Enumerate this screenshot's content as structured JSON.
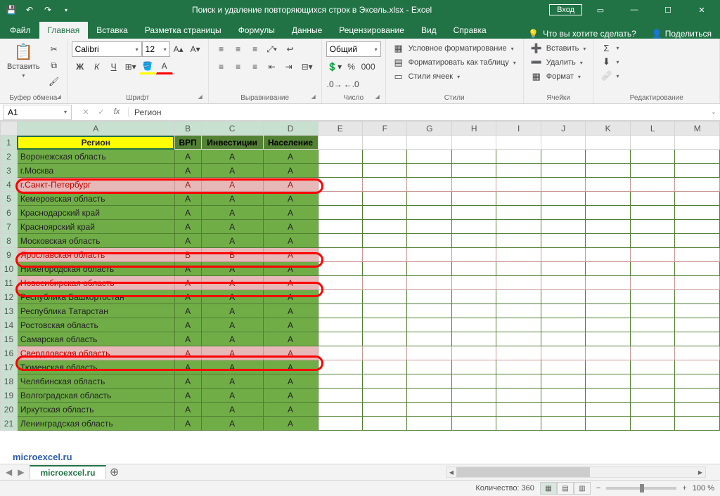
{
  "app": {
    "title": "Поиск и удаление повторяющихся строк в Эксель.xlsx - Excel",
    "signin": "Вход"
  },
  "tabs": {
    "file": "Файл",
    "home": "Главная",
    "insert": "Вставка",
    "layout": "Разметка страницы",
    "formulas": "Формулы",
    "data": "Данные",
    "review": "Рецензирование",
    "view": "Вид",
    "help": "Справка",
    "tellme": "Что вы хотите сделать?",
    "share": "Поделиться"
  },
  "ribbon": {
    "clipboard": {
      "paste": "Вставить",
      "label": "Буфер обмена"
    },
    "font": {
      "name": "Calibri",
      "size": "12",
      "label": "Шрифт",
      "bold": "Ж",
      "italic": "К",
      "underline": "Ч"
    },
    "alignment": {
      "label": "Выравнивание"
    },
    "number": {
      "format": "Общий",
      "label": "Число"
    },
    "styles": {
      "cond": "Условное форматирование",
      "table": "Форматировать как таблицу",
      "cell": "Стили ячеек",
      "label": "Стили"
    },
    "cells": {
      "insert": "Вставить",
      "delete": "Удалить",
      "format": "Формат",
      "label": "Ячейки"
    },
    "editing": {
      "label": "Редактирование"
    }
  },
  "formula_bar": {
    "cell_ref": "A1",
    "value": "Регион"
  },
  "columns": [
    "A",
    "B",
    "C",
    "D",
    "E",
    "F",
    "G",
    "H",
    "I",
    "J",
    "K",
    "L",
    "M"
  ],
  "headers": {
    "region": "Регион",
    "vrp": "ВРП",
    "invest": "Инвестиции",
    "pop": "Население"
  },
  "rows": [
    {
      "n": 2,
      "style": "green",
      "region": "Воронежская область",
      "b": "A",
      "c": "A",
      "d": "A"
    },
    {
      "n": 3,
      "style": "green",
      "region": "г.Москва",
      "b": "A",
      "c": "A",
      "d": "A"
    },
    {
      "n": 4,
      "style": "pink",
      "mark": true,
      "region": "г.Санкт-Петербург",
      "b": "A",
      "c": "A",
      "d": "A"
    },
    {
      "n": 5,
      "style": "green",
      "region": "Кемеровская область",
      "b": "A",
      "c": "A",
      "d": "A"
    },
    {
      "n": 6,
      "style": "green",
      "region": "Краснодарский край",
      "b": "A",
      "c": "A",
      "d": "A"
    },
    {
      "n": 7,
      "style": "green",
      "region": "Красноярский край",
      "b": "A",
      "c": "A",
      "d": "A"
    },
    {
      "n": 8,
      "style": "green",
      "region": "Московская область",
      "b": "A",
      "c": "A",
      "d": "A"
    },
    {
      "n": 9,
      "style": "pink",
      "mark": true,
      "region": "Ярославская область",
      "b": "B",
      "c": "B",
      "d": "A"
    },
    {
      "n": 10,
      "style": "green",
      "region": "Нижегородская область",
      "b": "A",
      "c": "A",
      "d": "A"
    },
    {
      "n": 11,
      "style": "pink",
      "mark": true,
      "region": "Новосибирская область",
      "b": "A",
      "c": "A",
      "d": "A"
    },
    {
      "n": 12,
      "style": "green",
      "region": "Республика Башкортостан",
      "b": "A",
      "c": "A",
      "d": "A"
    },
    {
      "n": 13,
      "style": "green",
      "region": "Республика Татарстан",
      "b": "A",
      "c": "A",
      "d": "A"
    },
    {
      "n": 14,
      "style": "green",
      "region": "Ростовская область",
      "b": "A",
      "c": "A",
      "d": "A"
    },
    {
      "n": 15,
      "style": "green",
      "region": "Самарская область",
      "b": "A",
      "c": "A",
      "d": "A"
    },
    {
      "n": 16,
      "style": "pink",
      "mark": true,
      "region": "Свердловская область",
      "b": "A",
      "c": "A",
      "d": "A"
    },
    {
      "n": 17,
      "style": "green",
      "region": "Тюменская область",
      "b": "A",
      "c": "A",
      "d": "A"
    },
    {
      "n": 18,
      "style": "green",
      "region": "Челябинская область",
      "b": "A",
      "c": "A",
      "d": "A"
    },
    {
      "n": 19,
      "style": "green",
      "region": "Волгоградская область",
      "b": "A",
      "c": "A",
      "d": "A"
    },
    {
      "n": 20,
      "style": "green",
      "region": "Иркутская область",
      "b": "A",
      "c": "A",
      "d": "A"
    },
    {
      "n": 21,
      "style": "green",
      "region": "Ленинградская область",
      "b": "A",
      "c": "A",
      "d": "A"
    }
  ],
  "sheet": {
    "name": "microexcel.ru"
  },
  "status": {
    "count_label": "Количество:",
    "count_val": "360",
    "zoom": "100 %"
  },
  "watermark": "microexcel.ru"
}
